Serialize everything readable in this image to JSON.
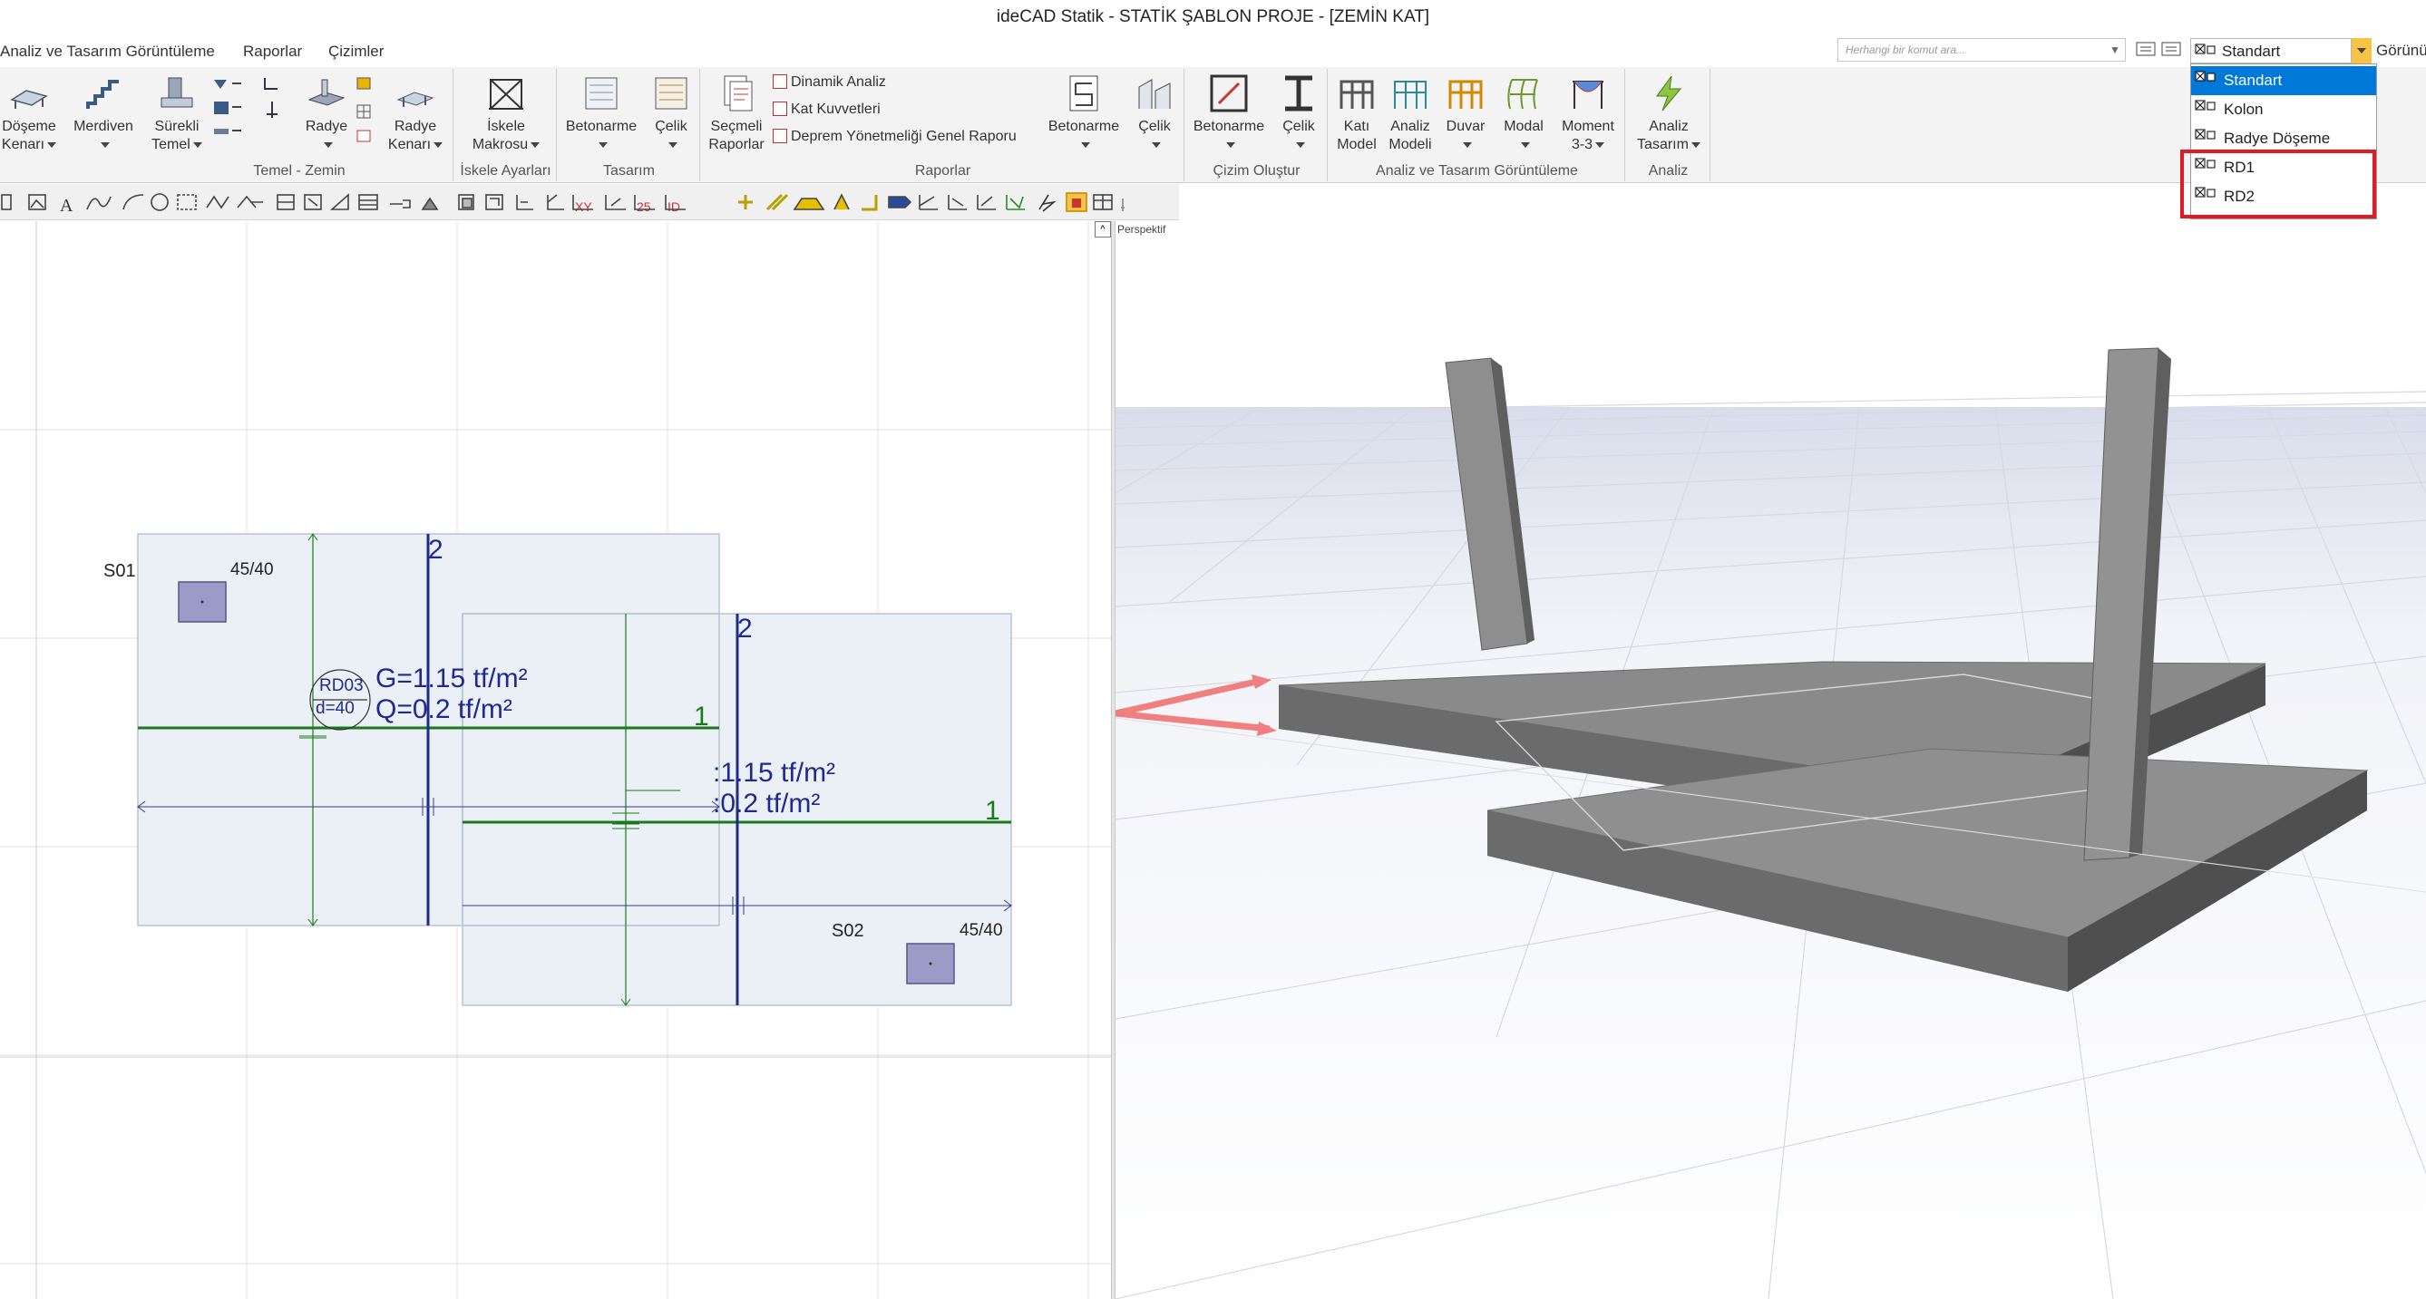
{
  "app": {
    "title": "ideCAD Statik - STATİK ŞABLON PROJE - [ZEMİN KAT]"
  },
  "menu": {
    "items": [
      "Analiz ve Tasarım Görüntüleme",
      "Raporlar",
      "Çizimler"
    ]
  },
  "ribbon": {
    "doseme_kenari": [
      "Döşeme",
      "Kenarı"
    ],
    "merdiven": "Merdiven",
    "surekli_temel": [
      "Sürekli",
      "Temel"
    ],
    "radye": "Radye",
    "radye_kenari": [
      "Radye",
      "Kenarı"
    ],
    "group_temel": "Temel - Zemin",
    "iskele_makrosu": [
      "İskele",
      "Makrosu"
    ],
    "group_iskele": "İskele Ayarları",
    "betonarme": "Betonarme",
    "celik": "Çelik",
    "group_tasarim": "Tasarım",
    "secmeli_raporlar": [
      "Seçmeli",
      "Raporlar"
    ],
    "dinamik_analiz": "Dinamik Analiz",
    "kat_kuvvetleri": "Kat Kuvvetleri",
    "deprem_raporu": "Deprem Yönetmeliği Genel Raporu",
    "rap_betonarme": "Betonarme",
    "rap_celik": "Çelik",
    "group_raporlar": "Raporlar",
    "ciz_betonarme": "Betonarme",
    "ciz_celik": "Çelik",
    "group_cizim": "Çizim Oluştur",
    "kati_model": [
      "Katı",
      "Model"
    ],
    "analiz_modeli": [
      "Analiz",
      "Modeli"
    ],
    "duvar": "Duvar",
    "modal": "Modal",
    "moment": [
      "Moment",
      "3-3"
    ],
    "group_analiz_gor": "Analiz ve Tasarım Görüntüleme",
    "analiz_tasarim": [
      "Analiz",
      "Tasarım"
    ],
    "group_analiz": "Analiz"
  },
  "search": {
    "placeholder": "Herhangi bir komut ara..."
  },
  "view_combo": {
    "value": "Standart",
    "right_label": "Görünü",
    "options": [
      "Standart",
      "Kolon",
      "Radye Döşeme",
      "RD1",
      "RD2"
    ],
    "selected_index": 0
  },
  "left_view": {
    "col1_label": "S01",
    "col1_size": "45/40",
    "col2_label": "S02",
    "col2_size": "45/40",
    "slab_id": "RD03",
    "slab_thickness": "d=40",
    "load_g": "G=1.15 tf/m²",
    "load_q": "Q=0.2 tf/m²",
    "load_g2": ":1.15 tf/m²",
    "load_q2": ":0.2 tf/m²",
    "axis_2a": "2",
    "axis_2b": "2",
    "axis_1a": "1",
    "axis_1b": "1"
  },
  "right_view": {
    "mode_label": "Perspektif"
  },
  "colors": {
    "highlight": "#e01b24",
    "selection": "#0078d7",
    "axis_blue": "#1f2a8c",
    "axis_green": "#1a7a1a"
  }
}
